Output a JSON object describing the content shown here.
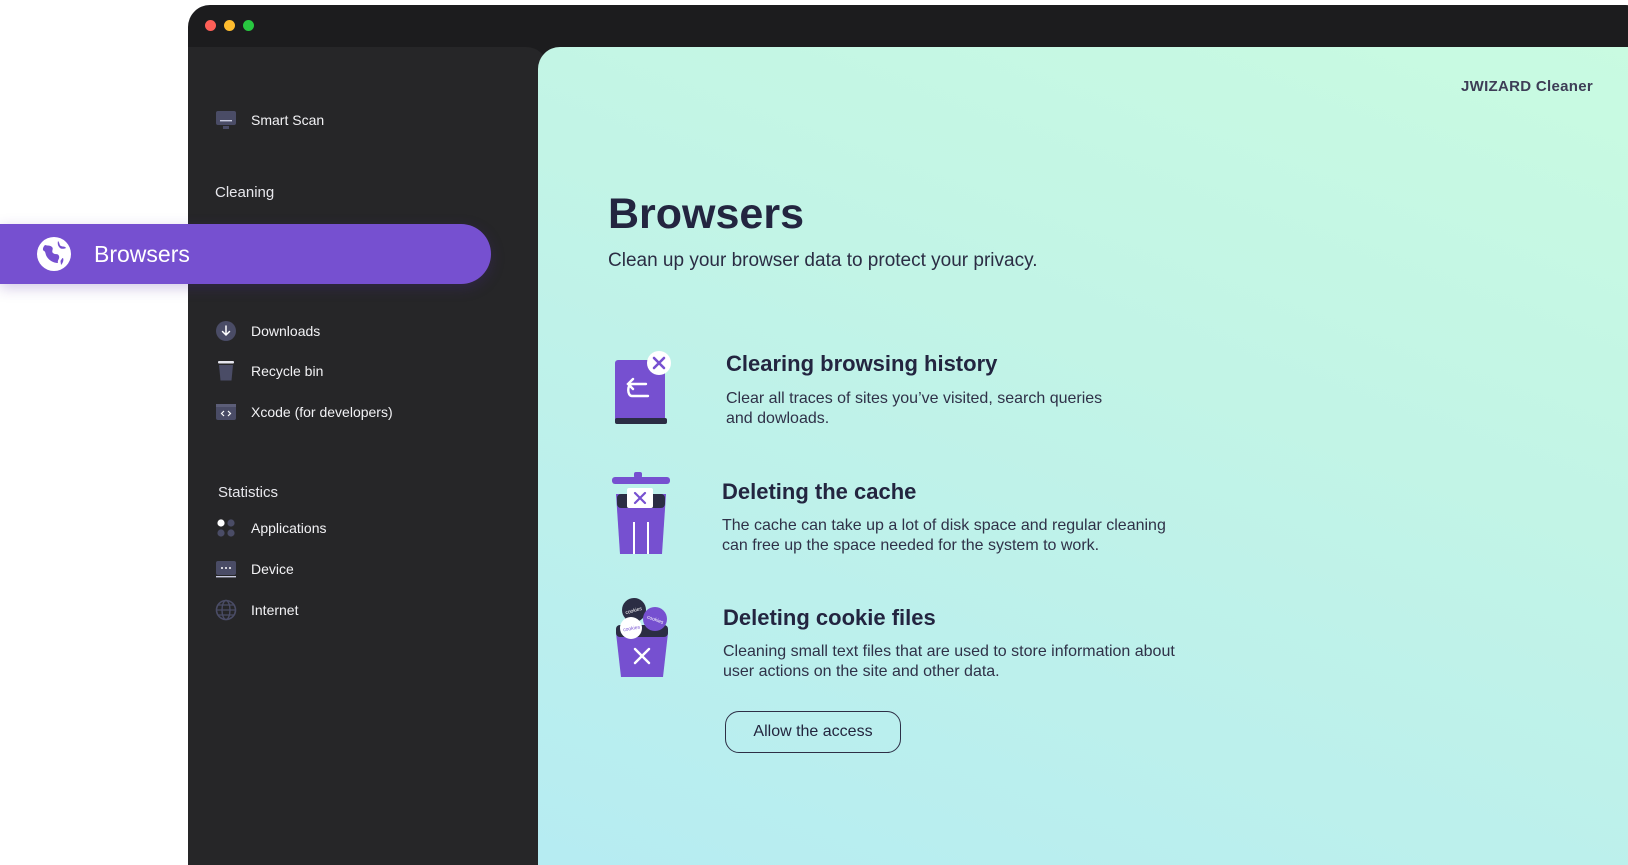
{
  "window": {
    "title": ""
  },
  "brand": "JWIZARD Cleaner",
  "sidebar": {
    "smart_scan": "Smart Scan",
    "cleaning_label": "Cleaning",
    "active_item": "Browsers",
    "cleaning_items": [
      {
        "label": "Downloads",
        "icon": "download-icon"
      },
      {
        "label": "Recycle bin",
        "icon": "recycle-bin-icon"
      },
      {
        "label": "Xcode (for developers)",
        "icon": "code-icon"
      }
    ],
    "statistics_label": "Statistics",
    "statistics_items": [
      {
        "label": "Applications",
        "icon": "applications-icon"
      },
      {
        "label": "Device",
        "icon": "device-icon"
      },
      {
        "label": "Internet",
        "icon": "globe-icon"
      }
    ]
  },
  "main": {
    "title": "Browsers",
    "subtitle": "Clean up your browser data to protect your privacy.",
    "features": [
      {
        "title": "Clearing browsing history",
        "desc_line1": "Clear all traces of sites you’ve visited, search queries",
        "desc_line2": "and dowloads."
      },
      {
        "title": "Deleting the cache",
        "desc_line1": "The cache can take up a lot of disk space and regular cleaning",
        "desc_line2": "can free up the space needed for the system to work."
      },
      {
        "title": "Deleting cookie files",
        "desc_line1": "Cleaning small text files that are used to store information about",
        "desc_line2": "user actions on the site and other data."
      }
    ],
    "allow_button": "Allow the access",
    "cookie_text": "cookies"
  },
  "colors": {
    "accent": "#7650d0",
    "sidebar_bg": "#262628",
    "title_text": "#232540"
  }
}
